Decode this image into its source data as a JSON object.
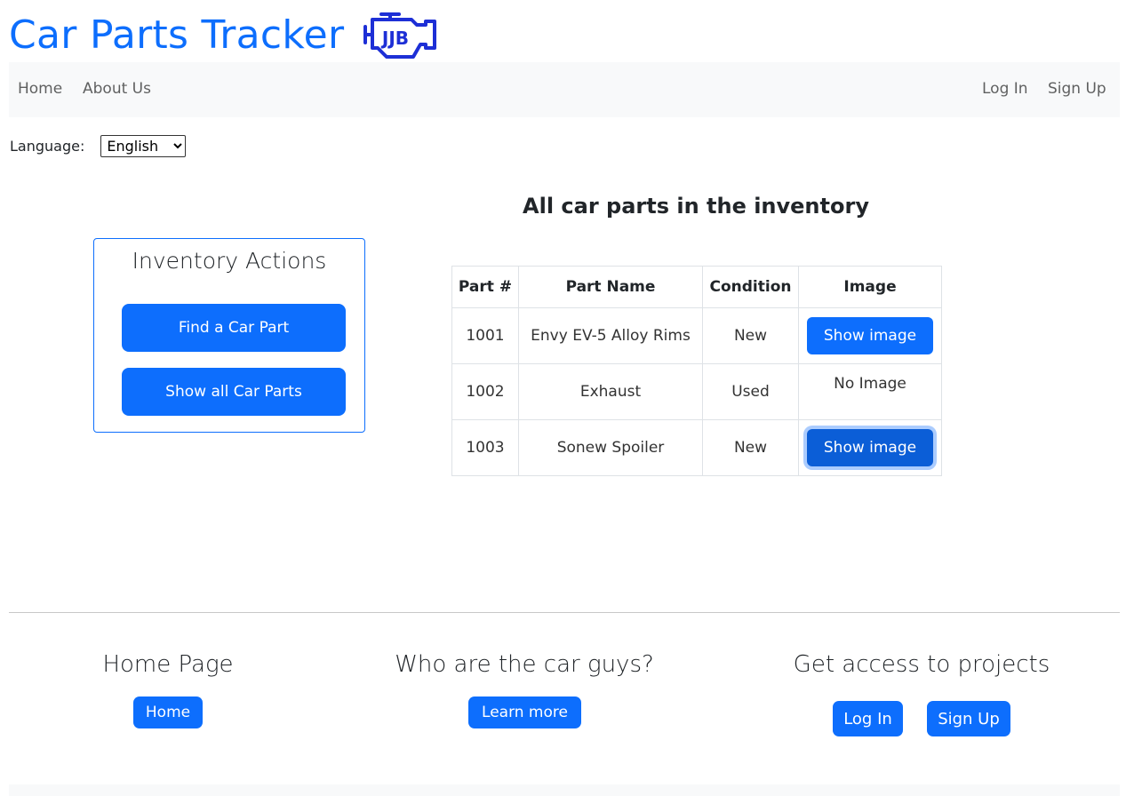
{
  "header": {
    "title": "Car Parts Tracker",
    "logo": {
      "icon": "engine-icon",
      "text": "JJB",
      "color": "#1d2fd6"
    }
  },
  "nav": {
    "left": [
      "Home",
      "About Us"
    ],
    "right": [
      "Log In",
      "Sign Up"
    ]
  },
  "language": {
    "label": "Language:",
    "selected": "English"
  },
  "inventory_actions": {
    "title": "Inventory Actions",
    "find_button": "Find a Car Part",
    "show_all_button": "Show all Car Parts"
  },
  "inventory": {
    "title": "All car parts in the inventory",
    "columns": [
      "Part #",
      "Part Name",
      "Condition",
      "Image"
    ],
    "rows": [
      {
        "part_no": "1001",
        "name": "Envy EV-5 Alloy Rims",
        "condition": "New",
        "image": "Show image"
      },
      {
        "part_no": "1002",
        "name": "Exhaust",
        "condition": "Used",
        "image": "No Image"
      },
      {
        "part_no": "1003",
        "name": "Sonew Spoiler",
        "condition": "New",
        "image": "Show image"
      }
    ]
  },
  "footer": {
    "home": {
      "title": "Home Page",
      "button": "Home"
    },
    "about": {
      "title": "Who are the car guys?",
      "button": "Learn more"
    },
    "access": {
      "title": "Get access to projects",
      "login": "Log In",
      "signup": "Sign Up"
    }
  },
  "colors": {
    "accent": "#0d6efd",
    "navbar_bg": "#f8f9fa"
  }
}
